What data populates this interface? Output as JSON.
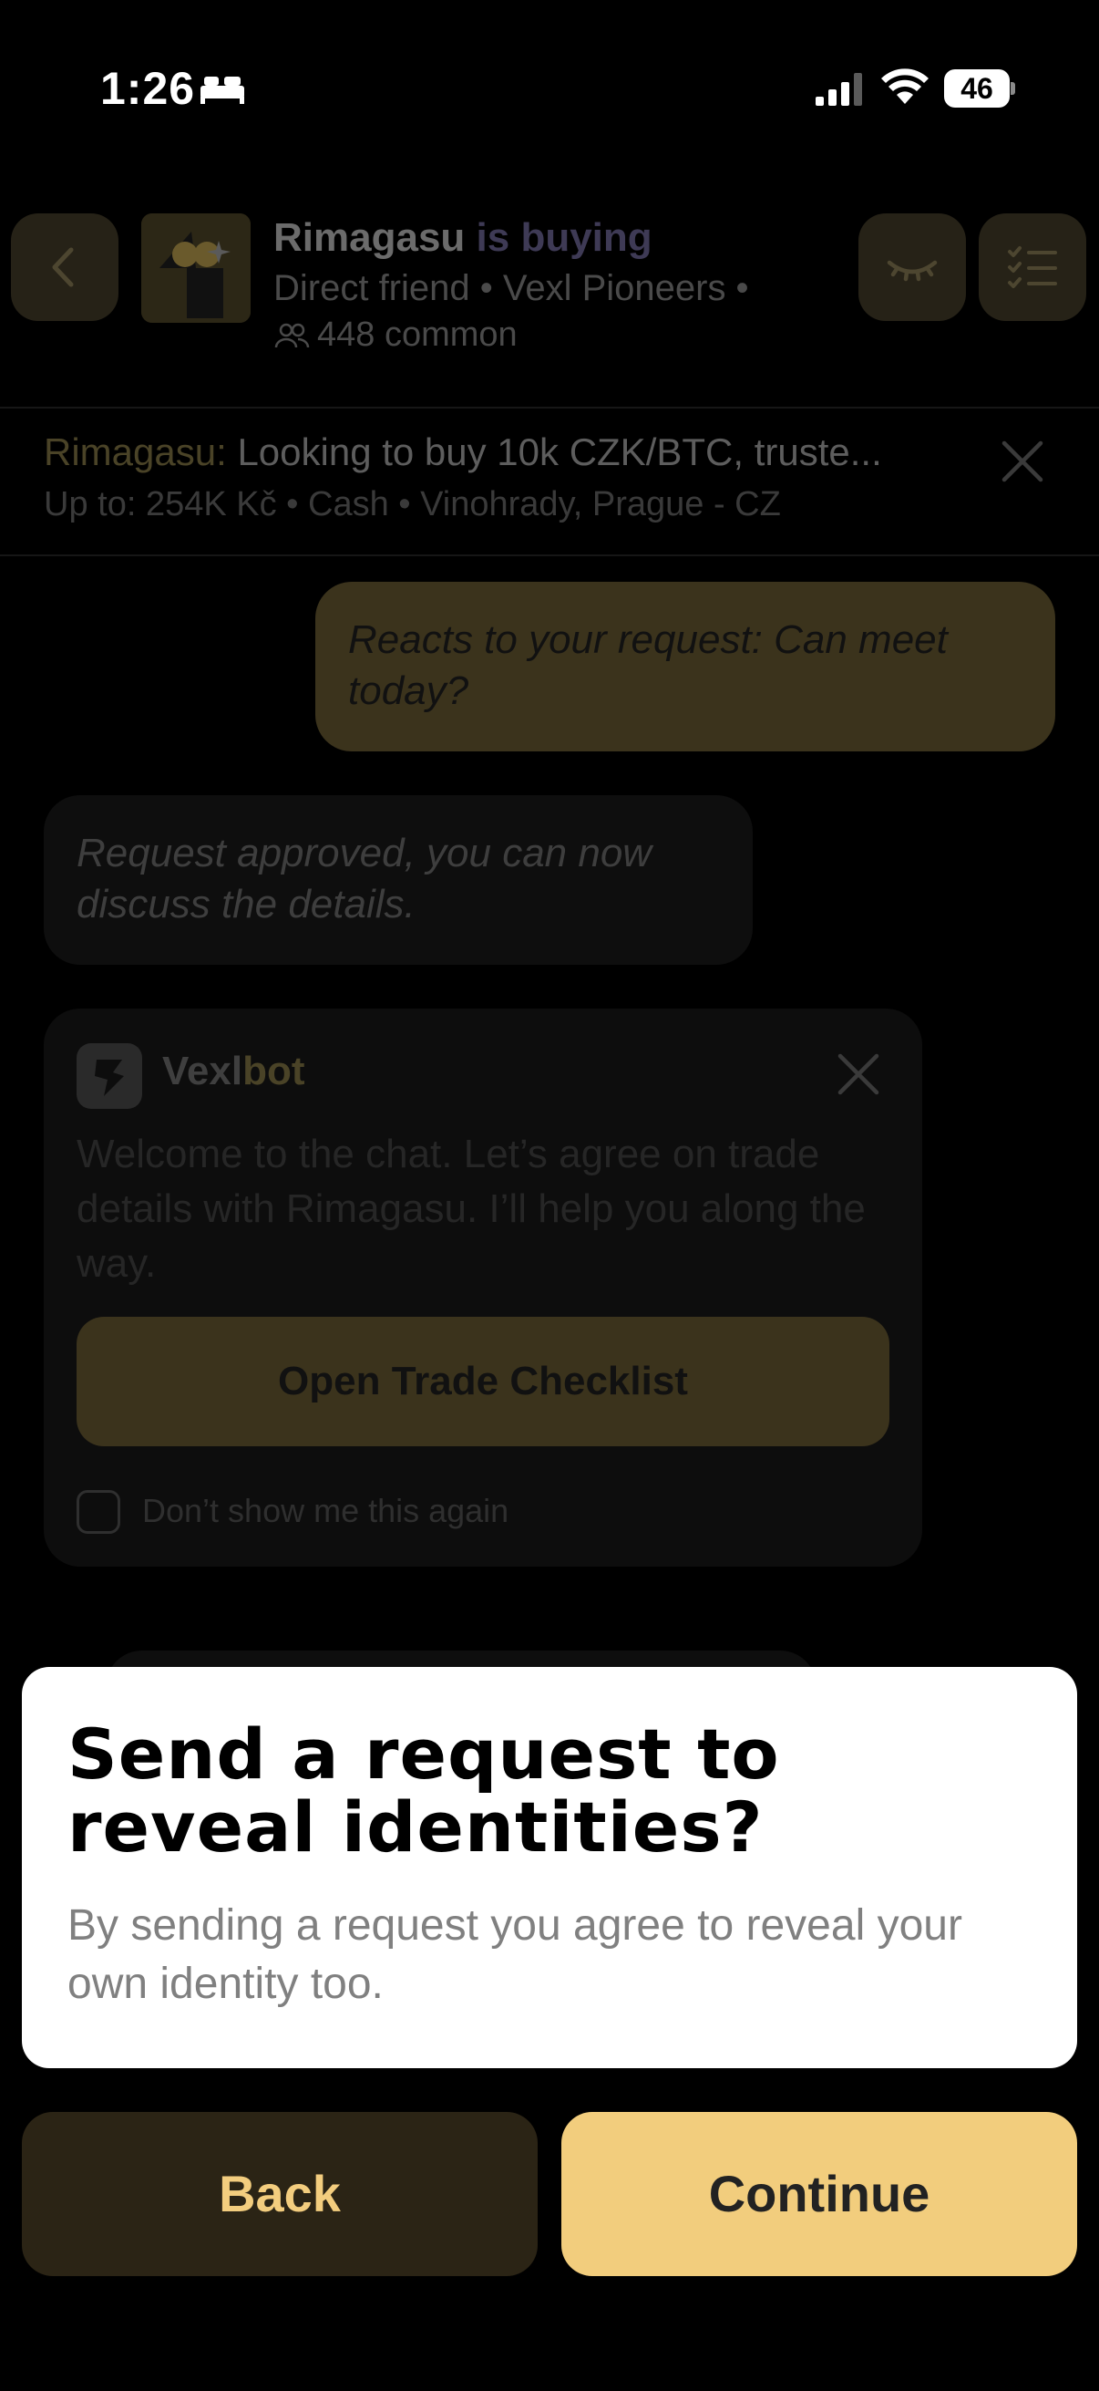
{
  "status_bar": {
    "time": "1:26",
    "battery": "46"
  },
  "header": {
    "name": "Rimagasu",
    "verb": "is buying",
    "subtitle": "Direct friend • Vexl Pioneers •",
    "common": "448 common"
  },
  "offer": {
    "owner": "Rimagasu:",
    "text": "Looking to buy 10k CZK/BTC, truste...",
    "meta": "Up to: 254K Kč  •  Cash  •  Vinohrady, Prague - CZ"
  },
  "messages": {
    "outgoing": "Reacts to your request: Can meet today?",
    "incoming": "Request approved, you can now discuss the details."
  },
  "bot": {
    "name_prefix": "Vexl",
    "name_suffix": "bot",
    "text": "Welcome to the chat. Let’s agree on trade details with Rimagasu. I’ll help you along the way.",
    "button": "Open Trade Checklist",
    "dont_show": "Don’t show me this again"
  },
  "modal": {
    "title": "Send a request to reveal identities?",
    "body": "By sending a request you agree to reveal your own identity too."
  },
  "actions": {
    "back": "Back",
    "continue": "Continue"
  },
  "colors": {
    "accent": "#f2cd7d",
    "accent_dark": "#2b2415",
    "background": "#000000"
  }
}
